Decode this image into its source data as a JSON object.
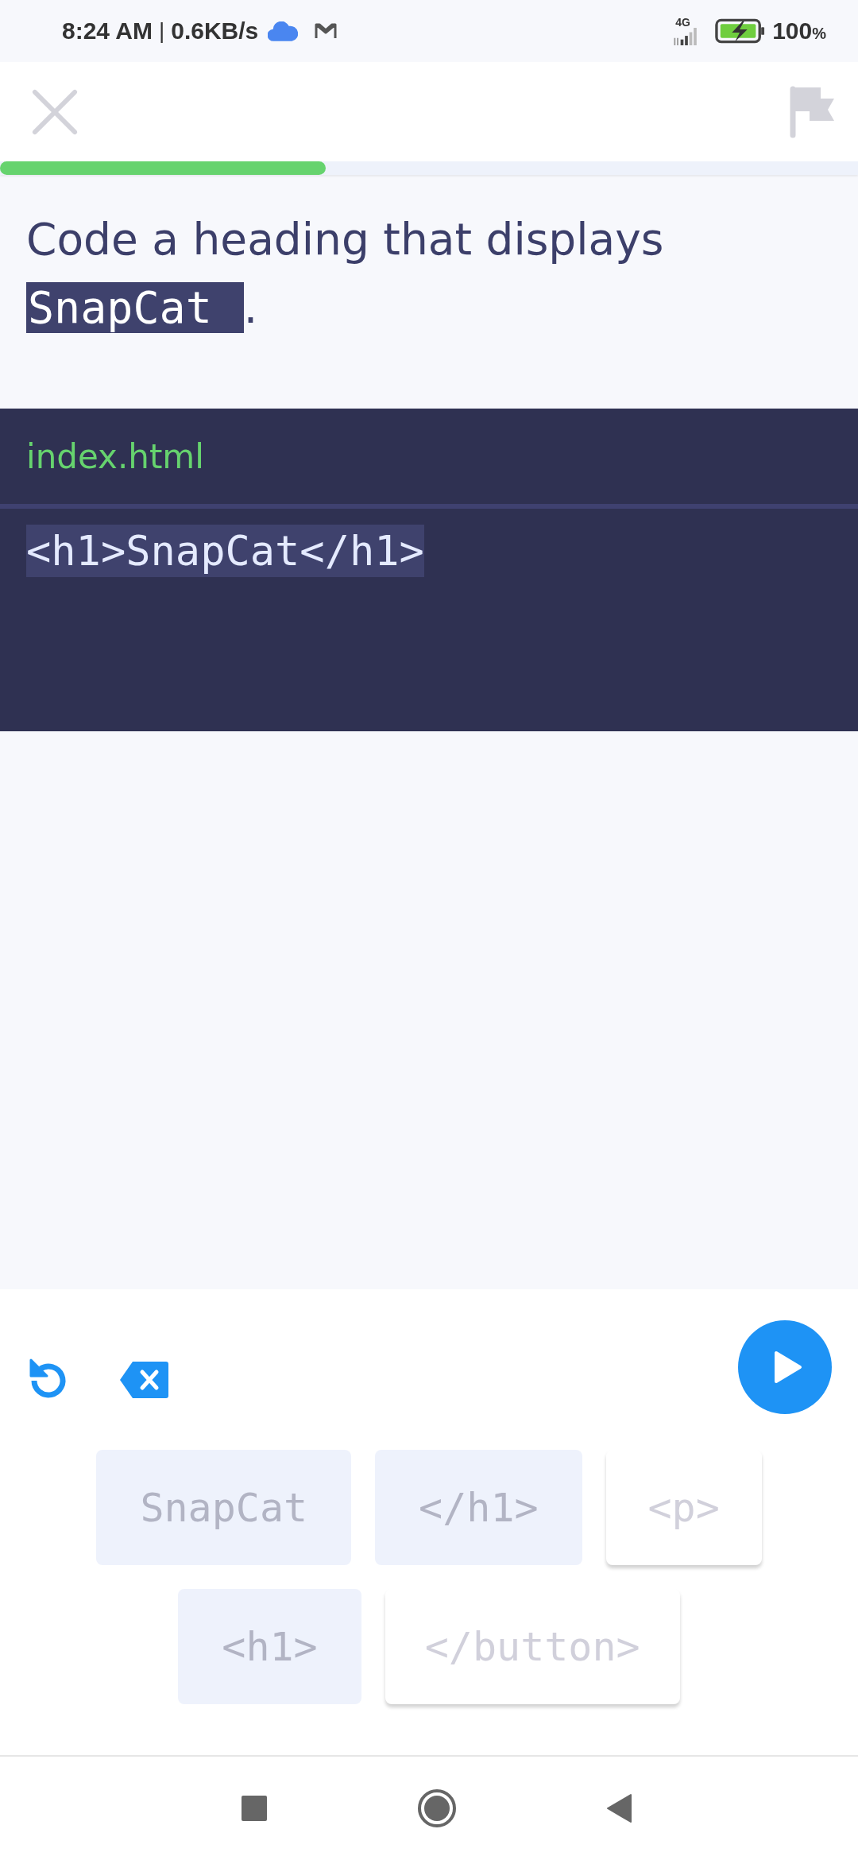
{
  "status_bar": {
    "time": "8:24 AM",
    "separator": "|",
    "speed": "0.6KB/s",
    "network": "4G",
    "battery": "100",
    "battery_unit": "%"
  },
  "progress": {
    "level": 0.38
  },
  "prompt": {
    "text": "Code a heading that displays",
    "answer": "SnapCat",
    "end": "."
  },
  "editor": {
    "filename": "index.html",
    "lines": [
      {
        "code": "<h1>SnapCat</h1>",
        "highlighted": true
      }
    ]
  },
  "tokens": [
    [
      {
        "label": "SnapCat",
        "used": true
      },
      {
        "label": "</h1>",
        "used": true
      },
      {
        "label": "<p>",
        "used": false
      }
    ],
    [
      {
        "label": "<h1>",
        "used": true
      },
      {
        "label": "</button>",
        "used": false
      }
    ]
  ]
}
